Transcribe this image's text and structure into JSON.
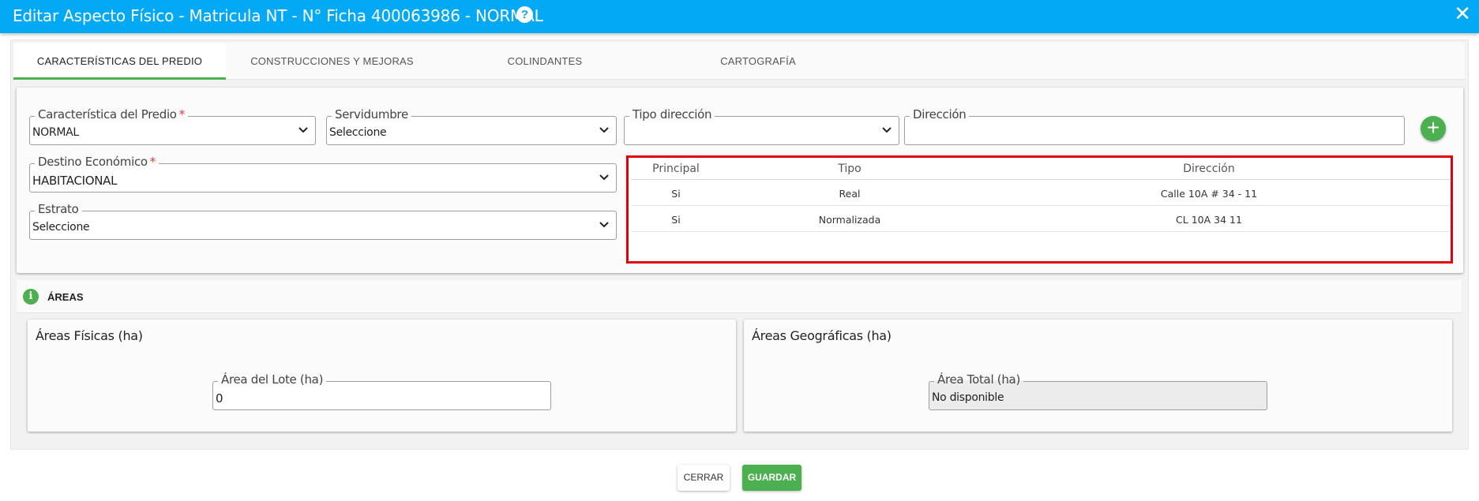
{
  "titlebar": {
    "title": "Editar Aspecto Físico - Matricula NT - N° Ficha 400063986 - NORMAL",
    "help_icon": "?",
    "close_icon": "✕"
  },
  "tabs": [
    {
      "label": "CARACTERÍSTICAS DEL PREDIO",
      "active": true
    },
    {
      "label": "CONSTRUCCIONES Y MEJORAS",
      "active": false
    },
    {
      "label": "COLINDANTES",
      "active": false
    },
    {
      "label": "CARTOGRAFÍA",
      "active": false
    }
  ],
  "form": {
    "caracteristica": {
      "label": "Característica del Predio",
      "required": "*",
      "value": "NORMAL"
    },
    "servidumbre": {
      "label": "Servidumbre",
      "value": "Seleccione"
    },
    "tipo_direccion": {
      "label": "Tipo dirección",
      "value": ""
    },
    "direccion": {
      "label": "Dirección",
      "value": ""
    },
    "destino": {
      "label": "Destino Económico",
      "required": "*",
      "value": "HABITACIONAL"
    },
    "estrato": {
      "label": "Estrato",
      "value": "Seleccione"
    },
    "add_icon": "+"
  },
  "address_table": {
    "headers": [
      "Principal",
      "Tipo",
      "Dirección"
    ],
    "rows": [
      [
        "Si",
        "Real",
        "Calle 10A # 34 - 11"
      ],
      [
        "Si",
        "Normalizada",
        "CL 10A 34 11"
      ]
    ]
  },
  "areas": {
    "section_title": "ÁREAS",
    "info_icon": "i",
    "fisicas": {
      "title": "Áreas Físicas (ha)",
      "lote_label": "Área del Lote (ha)",
      "lote_value": "0"
    },
    "geograficas": {
      "title": "Áreas Geográficas (ha)",
      "total_label": "Área Total (ha)",
      "total_value": "No disponible"
    }
  },
  "footer": {
    "cerrar": "CERRAR",
    "guardar": "GUARDAR"
  },
  "colors": {
    "titlebar": "#03a9f4",
    "accent": "#4caf50",
    "highlight": "#e0000f"
  }
}
